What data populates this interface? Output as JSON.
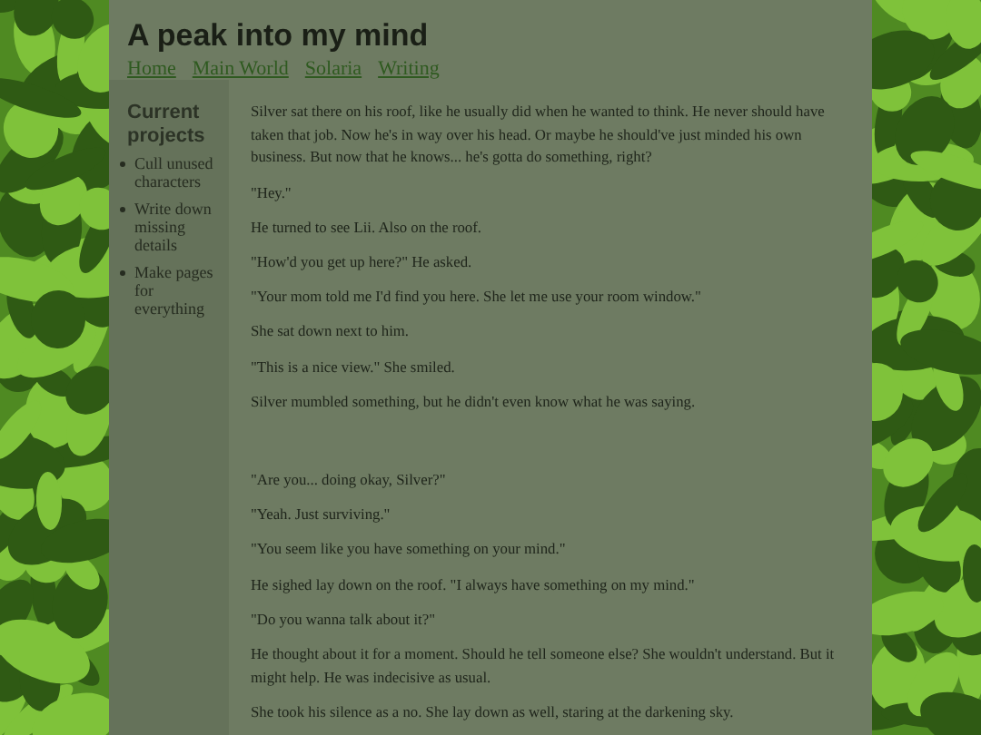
{
  "site": {
    "title": "A peak into my mind",
    "nav": [
      {
        "label": "Home"
      },
      {
        "label": "Main World"
      },
      {
        "label": "Solaria"
      },
      {
        "label": "Writing"
      }
    ]
  },
  "sidebar": {
    "title": "Current projects",
    "items": [
      "Cull unused characters",
      "Write down missing details",
      "Make pages for everything"
    ]
  },
  "story": {
    "paragraphs": [
      {
        "text": "Silver sat there on his roof, like he usually did when he wanted to think. He never should have taken that job. Now he's in way over his head. Or maybe he should've just minded his own business. But now that he knows... he's gotta do something, right?",
        "gap_before": false
      },
      {
        "text": "\"Hey.\"",
        "gap_before": false
      },
      {
        "text": "He turned to see Lii. Also on the roof.",
        "gap_before": false
      },
      {
        "text": "\"How'd you get up here?\" He asked.",
        "gap_before": false
      },
      {
        "text": "\"Your mom told me I'd find you here. She let me use your room window.\"",
        "gap_before": false
      },
      {
        "text": "She sat down next to him.",
        "gap_before": false
      },
      {
        "text": "\"This is a nice view.\" She smiled.",
        "gap_before": false
      },
      {
        "text": "Silver mumbled something, but he didn't even know what he was saying.",
        "gap_before": false
      },
      {
        "text": "\"Are you... doing okay, Silver?\"",
        "gap_before": true
      },
      {
        "text": "\"Yeah. Just surviving.\"",
        "gap_before": false
      },
      {
        "text": "\"You seem like you have something on your mind.\"",
        "gap_before": false
      },
      {
        "text": "He sighed lay down on the roof. \"I always have something on my mind.\"",
        "gap_before": false
      },
      {
        "text": "\"Do you wanna talk about it?\"",
        "gap_before": false
      },
      {
        "text": "He thought about it for a moment. Should he tell someone else? She wouldn't understand. But it might help. He was indecisive as usual.",
        "gap_before": false
      },
      {
        "text": "She took his silence as a no. She lay down as well, staring at the darkening sky.",
        "gap_before": false
      }
    ]
  }
}
